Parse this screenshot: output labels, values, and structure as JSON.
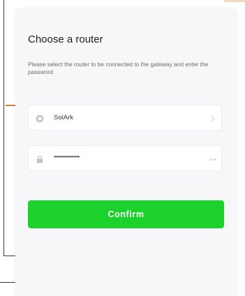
{
  "dialog": {
    "title": "Choose a router",
    "subtitle": "Please select the router to be connected to the gateway and enter the password"
  },
  "router_field": {
    "icon": "wifi-router-icon",
    "value": "SolArk",
    "trailing_icon": "chevron-right-icon"
  },
  "password_field": {
    "icon": "lock-icon",
    "value": "••••••••••••••••",
    "trailing_icon": "eye-closed-icon"
  },
  "confirm_button": {
    "label": "Confirm"
  },
  "colors": {
    "accent": "#1dd12c",
    "card_background": "#f7f7f9",
    "title_text": "#222222",
    "subtitle_text": "#6b6b6b"
  }
}
